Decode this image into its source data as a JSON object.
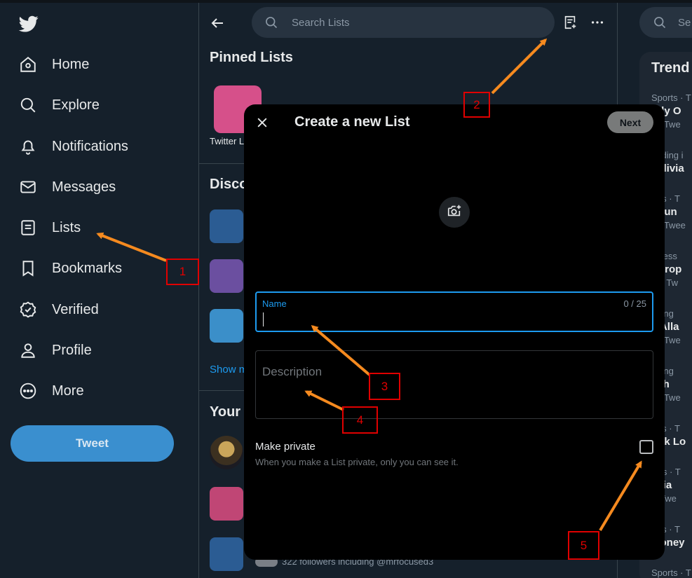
{
  "nav": {
    "items": [
      {
        "label": "Home",
        "icon": "home-icon"
      },
      {
        "label": "Explore",
        "icon": "search-icon"
      },
      {
        "label": "Notifications",
        "icon": "bell-icon"
      },
      {
        "label": "Messages",
        "icon": "envelope-icon"
      },
      {
        "label": "Lists",
        "icon": "list-icon"
      },
      {
        "label": "Bookmarks",
        "icon": "bookmark-icon"
      },
      {
        "label": "Verified",
        "icon": "verified-icon"
      },
      {
        "label": "Profile",
        "icon": "person-icon"
      },
      {
        "label": "More",
        "icon": "more-circle-icon"
      }
    ],
    "tweet_label": "Tweet"
  },
  "main": {
    "search_placeholder": "Search Lists",
    "pinned_title": "Pinned Lists",
    "pinned_item_label": "Twitter L",
    "discover_title": "Disco",
    "show_more": "Show m",
    "your_lists_title": "Your",
    "followers_text": "322 followers including @mrfocused3"
  },
  "right": {
    "search_placeholder": "Se",
    "trends_title": "Trend",
    "trends": [
      {
        "cat": "Sports · T",
        "name": "ndy O",
        "cnt": "20 Twe"
      },
      {
        "cat": "ending i",
        "name": "aldivia",
        "cnt": ""
      },
      {
        "cat": "orts · T",
        "name": "ngun",
        "cnt": "01 Twee"
      },
      {
        "cat": "siness",
        "name": "irdrop",
        "cnt": "4M Tw"
      },
      {
        "cat": "nding",
        "name": "y Alla",
        "cnt": "72 Twe"
      },
      {
        "cat": "nding",
        "name": "llah",
        "cnt": "55 Twe"
      },
      {
        "cat": "orts · T",
        "name": "ook Lo",
        "cnt": ""
      },
      {
        "cat": "itics · T",
        "name": "ssia",
        "cnt": "K Twe"
      },
      {
        "cat": "orts · T",
        "name": "Money",
        "cnt": ""
      },
      {
        "cat": "Sports · T",
        "name": "",
        "cnt": ""
      }
    ]
  },
  "modal": {
    "title": "Create a new List",
    "next_label": "Next",
    "name_label": "Name",
    "name_counter": "0 / 25",
    "description_placeholder": "Description",
    "private_label": "Make private",
    "private_sub": "When you make a List private, only you can see it."
  },
  "annotations": [
    "1",
    "2",
    "3",
    "4",
    "5"
  ],
  "colors": {
    "background": "#15202b",
    "accent": "#1d9bf0",
    "tweet_button": "#3a8fcf",
    "modal": "#000000",
    "arrow": "#f58a1f",
    "annotation_box": "#e00000"
  }
}
